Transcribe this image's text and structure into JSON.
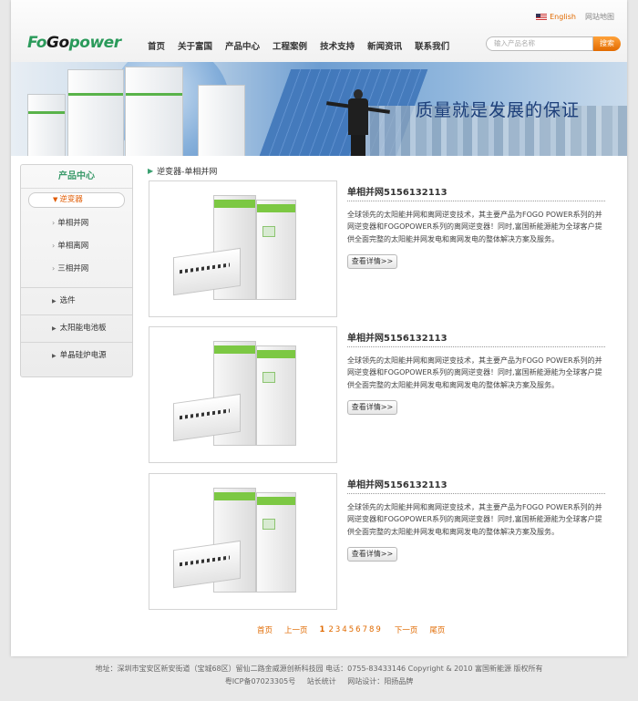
{
  "header": {
    "english_label": "English",
    "sitemap_label": "网站地图",
    "logo": {
      "part1": "Fo",
      "part2": "Go",
      "part3": "power"
    },
    "nav": [
      "首页",
      "关于富国",
      "产品中心",
      "工程案例",
      "技术支持",
      "新闻资讯",
      "联系我们"
    ],
    "search_placeholder": "输入产品名称",
    "search_button": "搜索"
  },
  "banner": {
    "slogan": "质量就是发展的保证"
  },
  "sidebar": {
    "title": "产品中心",
    "active": "逆变器",
    "sub_items": [
      "单相并网",
      "单相离网",
      "三相并网"
    ],
    "categories": [
      "选件",
      "太阳能电池板",
      "单晶硅炉电源"
    ]
  },
  "breadcrumb": "逆变器-单相并网",
  "products": [
    {
      "title": "单相并网5156132113",
      "desc": "全球领先的太阳能并网和离网逆变技术，其主要产品为FOGO POWER系列的并网逆变器和FOGOPOWER系列的离网逆变器！同时,富国新能源能为全球客户提供全面完整的太阳能并网发电和离网发电的整体解决方案及服务。",
      "more": "查看详情>>"
    },
    {
      "title": "单相并网5156132113",
      "desc": "全球领先的太阳能并网和离网逆变技术，其主要产品为FOGO POWER系列的并网逆变器和FOGOPOWER系列的离网逆变器！同时,富国新能源能为全球客户提供全面完整的太阳能并网发电和离网发电的整体解决方案及服务。",
      "more": "查看详情>>"
    },
    {
      "title": "单相并网5156132113",
      "desc": "全球领先的太阳能并网和离网逆变技术，其主要产品为FOGO POWER系列的并网逆变器和FOGOPOWER系列的离网逆变器！同时,富国新能源能为全球客户提供全面完整的太阳能并网发电和离网发电的整体解决方案及服务。",
      "more": "查看详情>>"
    }
  ],
  "pager": {
    "first": "首页",
    "prev": "上一页",
    "pages": [
      "1",
      "2",
      "3",
      "4",
      "5",
      "6",
      "7",
      "8",
      "9"
    ],
    "current": "1",
    "next": "下一页",
    "last": "尾页"
  },
  "footer": {
    "line1": "地址：深圳市宝安区新安街道（宝城68区）留仙二路金威源创新科技园   电话：0755-83433146   Copyright & 2010 富国新能源 版权所有",
    "icp": "粤ICP备07023305号",
    "stats": "站长统计",
    "design": "网站设计：阳扬品牌"
  },
  "colors": {
    "accent_orange": "#e06a00",
    "brand_green": "#2a9a5a",
    "slogan_blue": "#1d3f7a"
  }
}
